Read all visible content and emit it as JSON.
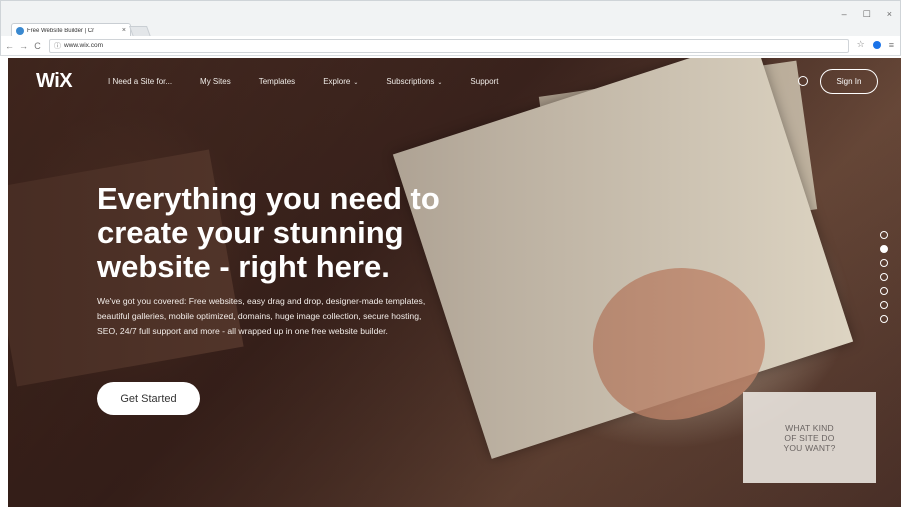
{
  "browser": {
    "tab": {
      "title": "Free Website Builder | Cr",
      "close": "×"
    },
    "window_controls": {
      "minimize": "–",
      "maximize": "☐",
      "close": "×"
    },
    "nav": {
      "back": "←",
      "forward": "→",
      "reload": "C"
    },
    "address": {
      "icon": "ⓘ",
      "url": "www.wix.com"
    },
    "toolbar_icons": {
      "star": "☆",
      "menu": "≡"
    }
  },
  "site": {
    "logo": "WiX",
    "nav_items": [
      {
        "label": "I Need a Site for..."
      },
      {
        "label": "My Sites"
      },
      {
        "label": "Templates"
      },
      {
        "label": "Explore",
        "caret": "⌄"
      },
      {
        "label": "Subscriptions",
        "caret": "⌄"
      },
      {
        "label": "Support"
      }
    ],
    "sign_in": "Sign In",
    "hero": {
      "title": "Everything you need to create your stunning website - right here.",
      "subtitle": "We've got you covered: Free websites, easy drag and drop, designer-made templates, beautiful galleries, mobile optimized, domains, huge image collection, secure hosting, SEO, 24/7 full support and more - all wrapped up in one free website builder.",
      "cta": "Get Started"
    },
    "slider": {
      "count": 7,
      "active_index": 1
    },
    "card": {
      "text": "WHAT KIND OF SITE DO YOU WANT?"
    }
  }
}
